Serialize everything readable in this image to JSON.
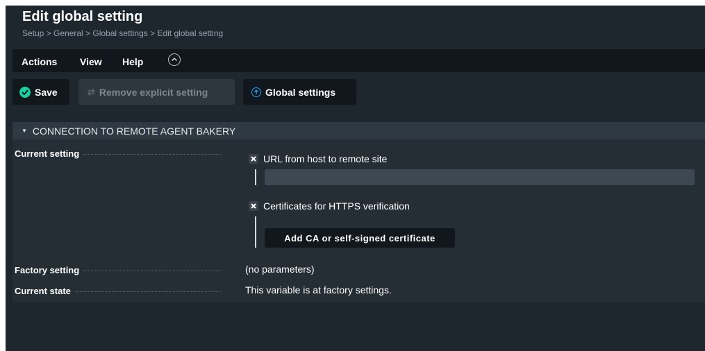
{
  "header": {
    "title": "Edit global setting",
    "breadcrumb": "Setup > General > Global settings > Edit global setting"
  },
  "menu": {
    "items": [
      "Actions",
      "View",
      "Help"
    ],
    "collapse_icon": "chevron-up-circle-icon"
  },
  "toolbar": {
    "save_label": "Save",
    "remove_label": "Remove explicit setting",
    "global_label": "Global settings"
  },
  "section": {
    "title": "CONNECTION TO REMOTE AGENT BAKERY",
    "current_setting_label": "Current setting",
    "url_label": "URL from host to remote site",
    "url_value": "",
    "cert_label": "Certificates for HTTPS verification",
    "add_cert_label": "Add CA or self-signed certificate",
    "factory_label": "Factory setting",
    "factory_value": "(no parameters)",
    "state_label": "Current state",
    "state_value": "This variable is at factory settings."
  },
  "colors": {
    "background": "#1e262e",
    "menubar": "#11171c",
    "accent_green": "#15d1a0",
    "accent_blue": "#26a5ff"
  }
}
